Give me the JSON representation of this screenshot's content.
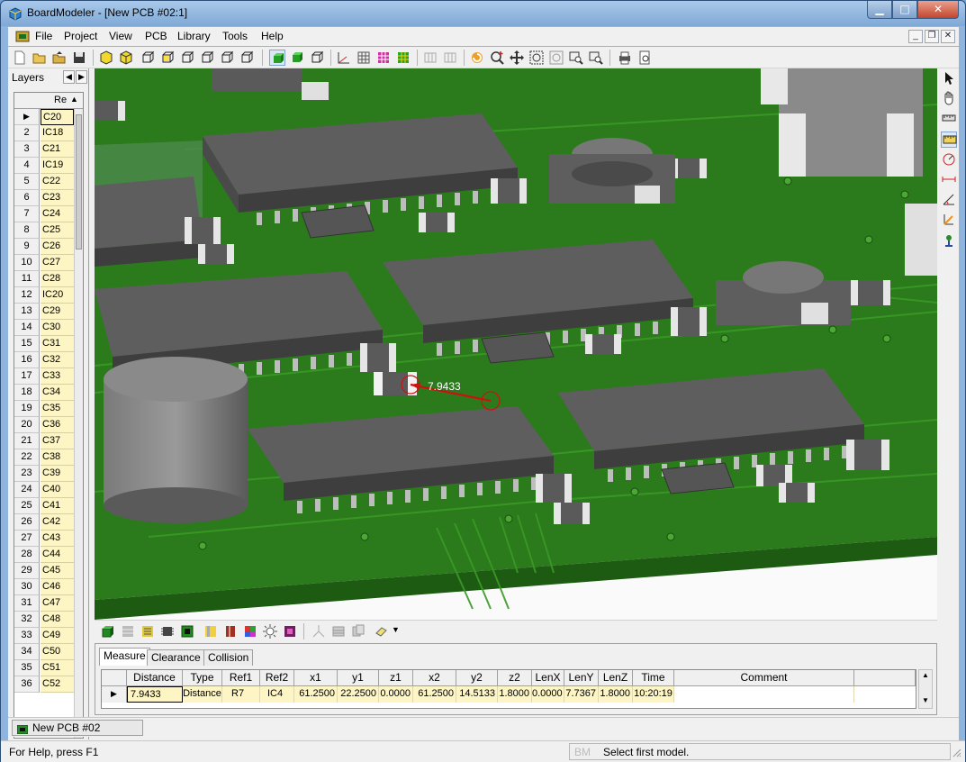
{
  "window": {
    "title": "BoardModeler - [New PCB #02:1]"
  },
  "menu": [
    "File",
    "Project",
    "View",
    "PCB",
    "Library",
    "Tools",
    "Help"
  ],
  "layers_panel": {
    "tab": "Layers",
    "column_header": "Re",
    "rows": [
      {
        "n": "1",
        "ref": "C20"
      },
      {
        "n": "2",
        "ref": "IC18"
      },
      {
        "n": "3",
        "ref": "C21"
      },
      {
        "n": "4",
        "ref": "IC19"
      },
      {
        "n": "5",
        "ref": "C22"
      },
      {
        "n": "6",
        "ref": "C23"
      },
      {
        "n": "7",
        "ref": "C24"
      },
      {
        "n": "8",
        "ref": "C25"
      },
      {
        "n": "9",
        "ref": "C26"
      },
      {
        "n": "10",
        "ref": "C27"
      },
      {
        "n": "11",
        "ref": "C28"
      },
      {
        "n": "12",
        "ref": "IC20"
      },
      {
        "n": "13",
        "ref": "C29"
      },
      {
        "n": "14",
        "ref": "C30"
      },
      {
        "n": "15",
        "ref": "C31"
      },
      {
        "n": "16",
        "ref": "C32"
      },
      {
        "n": "17",
        "ref": "C33"
      },
      {
        "n": "18",
        "ref": "C34"
      },
      {
        "n": "19",
        "ref": "C35"
      },
      {
        "n": "20",
        "ref": "C36"
      },
      {
        "n": "21",
        "ref": "C37"
      },
      {
        "n": "22",
        "ref": "C38"
      },
      {
        "n": "23",
        "ref": "C39"
      },
      {
        "n": "24",
        "ref": "C40"
      },
      {
        "n": "25",
        "ref": "C41"
      },
      {
        "n": "26",
        "ref": "C42"
      },
      {
        "n": "27",
        "ref": "C43"
      },
      {
        "n": "28",
        "ref": "C44"
      },
      {
        "n": "29",
        "ref": "C45"
      },
      {
        "n": "30",
        "ref": "C46"
      },
      {
        "n": "31",
        "ref": "C47"
      },
      {
        "n": "32",
        "ref": "C48"
      },
      {
        "n": "33",
        "ref": "C49"
      },
      {
        "n": "34",
        "ref": "C50"
      },
      {
        "n": "35",
        "ref": "C51"
      },
      {
        "n": "36",
        "ref": "C52"
      }
    ]
  },
  "viewport": {
    "measurement_label": "7.9433"
  },
  "measure_panel": {
    "tabs": [
      "Measure",
      "Clearance",
      "Collision"
    ],
    "columns": [
      "Distance",
      "Type",
      "Ref1",
      "Ref2",
      "x1",
      "y1",
      "z1",
      "x2",
      "y2",
      "z2",
      "LenX",
      "LenY",
      "LenZ",
      "Time",
      "Comment"
    ],
    "row": {
      "distance": "7.9433",
      "type": "Distance",
      "ref1": "R7",
      "ref2": "IC4",
      "x1": "61.2500",
      "y1": "22.2500",
      "z1": "0.0000",
      "x2": "61.2500",
      "y2": "14.5133",
      "z2": "1.8000",
      "lenx": "0.0000",
      "leny": "7.7367",
      "lenz": "1.8000",
      "time": "10:20:19",
      "comment": ""
    }
  },
  "doc_tab": "New PCB #02",
  "status": {
    "help": "For Help, press F1",
    "dim_indicator": "BM",
    "message": "Select first model."
  },
  "colors": {
    "board": "#2a6a18",
    "chip": "#555555",
    "accent_measure": "#d01010",
    "cell_yellow": "#fdf5c4"
  }
}
